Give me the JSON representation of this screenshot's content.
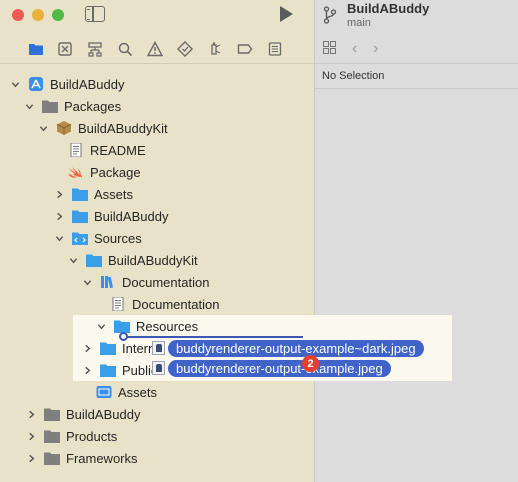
{
  "window": {
    "traffic_lights": [
      "#ee5b53",
      "#e9b13a",
      "#4fbb43"
    ]
  },
  "navigator_toolbar": {
    "icons": [
      "folder-icon",
      "source-control-icon",
      "hierarchy-icon",
      "search-icon",
      "warning-icon",
      "test-icon",
      "debug-icon",
      "breakpoint-icon",
      "report-icon"
    ]
  },
  "tree": {
    "project": "BuildABuddy",
    "packages": "Packages",
    "kit": "BuildABuddyKit",
    "readme": "README",
    "package": "Package",
    "assets": "Assets",
    "buildabuddy_folder": "BuildABuddy",
    "sources": "Sources",
    "sources_kit": "BuildABuddyKit",
    "documentation": "Documentation",
    "documentation_file": "Documentation",
    "resources": "Resources",
    "internal_partial": "Intern",
    "public_partial": "Public",
    "assets2": "Assets",
    "buildabuddy_group": "BuildABuddy",
    "products": "Products",
    "frameworks": "Frameworks"
  },
  "drag": {
    "file1": "buddyrenderer-output-example~dark.jpeg",
    "file2": "buddyrenderer-output-example.jpeg",
    "count": "2"
  },
  "right_pane": {
    "title": "BuildABuddy",
    "branch": "main",
    "no_selection": "No Selection"
  },
  "colors": {
    "folder_blue": "#3a9ee8",
    "accent": "#3f63c9",
    "badge": "#e2402f"
  }
}
